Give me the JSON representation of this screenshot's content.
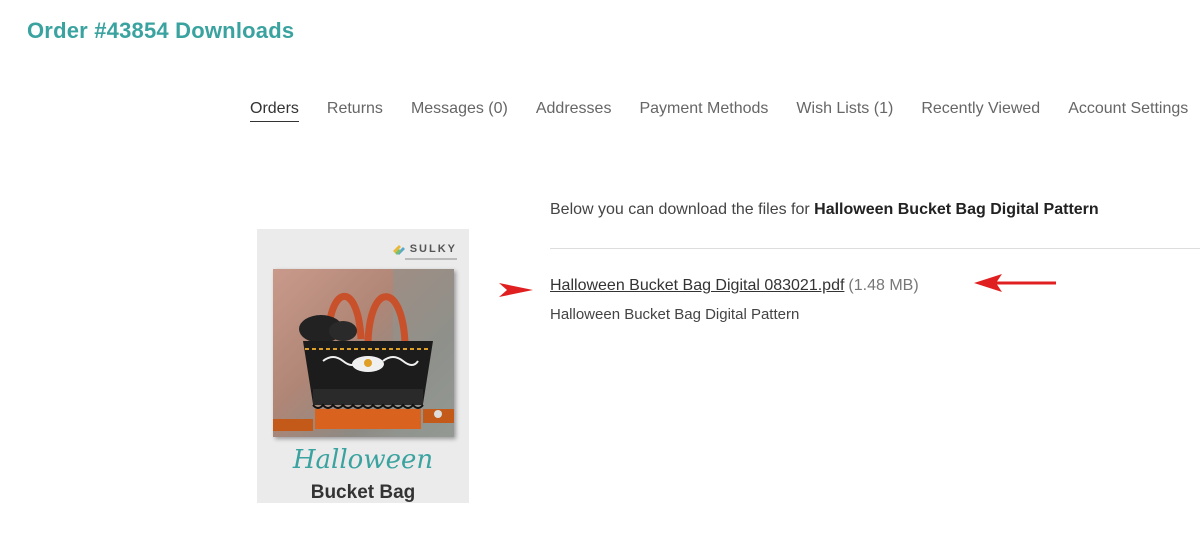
{
  "page": {
    "title": "Order #43854 Downloads"
  },
  "nav": {
    "items": [
      {
        "label": "Orders",
        "active": true
      },
      {
        "label": "Returns"
      },
      {
        "label": "Messages (0)"
      },
      {
        "label": "Addresses"
      },
      {
        "label": "Payment Methods"
      },
      {
        "label": "Wish Lists (1)"
      },
      {
        "label": "Recently Viewed"
      },
      {
        "label": "Account Settings"
      }
    ]
  },
  "product": {
    "brand": "SULKY",
    "script_title": "Halloween",
    "bold_title": "Bucket Bag"
  },
  "downloads": {
    "intro": "Below you can download the files for ",
    "product_name": "Halloween Bucket Bag Digital Pattern",
    "files": [
      {
        "name": "Halloween Bucket Bag Digital 083021.pdf",
        "size": "(1.48 MB)",
        "description": "Halloween Bucket Bag Digital Pattern"
      }
    ]
  },
  "colors": {
    "accent": "#3aa3a0",
    "annotation_arrow": "#e02020"
  }
}
